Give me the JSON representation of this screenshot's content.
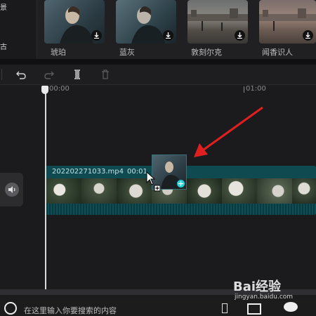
{
  "left_categories": [
    "景",
    "古"
  ],
  "filters": [
    {
      "name": "琥珀",
      "icon": "download-icon"
    },
    {
      "name": "蓝灰",
      "icon": "download-icon"
    },
    {
      "name": "敦刻尔克",
      "icon": "download-icon"
    },
    {
      "name": "闻香识人",
      "icon": "download-icon"
    }
  ],
  "toolbar": {
    "icons": [
      "undo-icon",
      "redo-icon",
      "split-icon",
      "delete-icon"
    ]
  },
  "ruler": {
    "labels": [
      "00:00",
      "01:00"
    ]
  },
  "track": {
    "filename": "202202271033.mp4",
    "duration": "00:01"
  },
  "colors": {
    "accent": "#1fd0d6",
    "track": "#0d3f45",
    "arrow": "#e02020"
  },
  "watermark": {
    "text": "Bai经验",
    "url": "jingyan.baidu.com"
  },
  "taskbar": {
    "search_placeholder": "在这里输入你要搜索的内容"
  }
}
